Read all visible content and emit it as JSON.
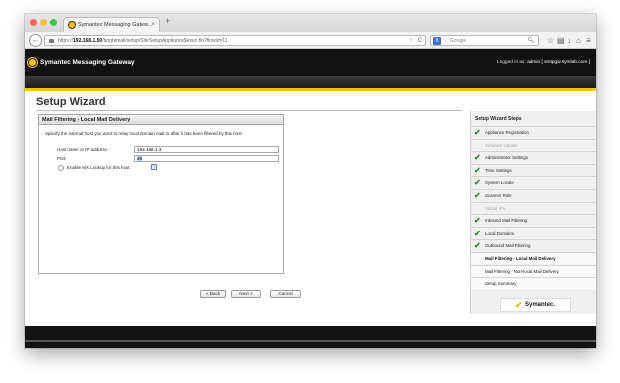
{
  "browser": {
    "tab_title": "Symantec Messaging Gatew...",
    "tab_close": "×",
    "new_tab": "+",
    "back_icon": "←",
    "url_prefix": "https://",
    "url_domain": "192.168.1.50",
    "url_path": "/brightmail/setup/SiteSetupAppliance$exec.flo?flowid=11",
    "url_caret": "▽",
    "reload_icon": "C",
    "search_engine": "8",
    "search_placeholder": "Google",
    "search_icon": "🔍︎",
    "toolbar_icons": {
      "star": "☆",
      "library": "▤",
      "downloads": "↓",
      "home": "⌂",
      "menu": "≡"
    },
    "light_colors": [
      "#fc605c",
      "#fdbc40",
      "#34c84a"
    ]
  },
  "app": {
    "product_name": "Symantec Messaging Gateway",
    "logged_in_label": "Logged in as:",
    "logged_in_user": "admin [ smtpgw.symlab.com ]"
  },
  "wizard": {
    "title": "Setup Wizard",
    "panel_title": "Mail Filtering - Local Mail Delivery",
    "description": "Specify the internal host you want to relay local domain mail to after it has been filtered by this host.",
    "host_label": "Host name or IP address:",
    "host_value": "192.168.1.3",
    "port_label": "Port:",
    "port_value": "25",
    "mx_label": "Enable MX Lookup for this host",
    "help_icon": "?",
    "back_button": "< Back",
    "next_button": "Next >",
    "cancel_button": "Cancel"
  },
  "sidebar": {
    "title": "Setup Wizard Steps",
    "check_glyph": "✔",
    "items": [
      {
        "label": "Appliance Registration",
        "state": "done"
      },
      {
        "label": "Software Update",
        "state": "disabled"
      },
      {
        "label": "Administrator Settings",
        "state": "done"
      },
      {
        "label": "Time Settings",
        "state": "done"
      },
      {
        "label": "System Locale",
        "state": "done"
      },
      {
        "label": "Scanner Role",
        "state": "done"
      },
      {
        "label": "Virtual IPs",
        "state": "disabled"
      },
      {
        "label": "Inbound Mail Filtering",
        "state": "done"
      },
      {
        "label": "Local Domains",
        "state": "done"
      },
      {
        "label": "Outbound Mail Filtering",
        "state": "done"
      },
      {
        "label": "Mail Filtering - Local Mail Delivery",
        "state": "current"
      },
      {
        "label": "Mail Filtering - Non-local Mail Delivery",
        "state": "pending"
      },
      {
        "label": "Setup Summary",
        "state": "pending"
      }
    ],
    "brand_check": "✔",
    "brand": "Symantec."
  }
}
